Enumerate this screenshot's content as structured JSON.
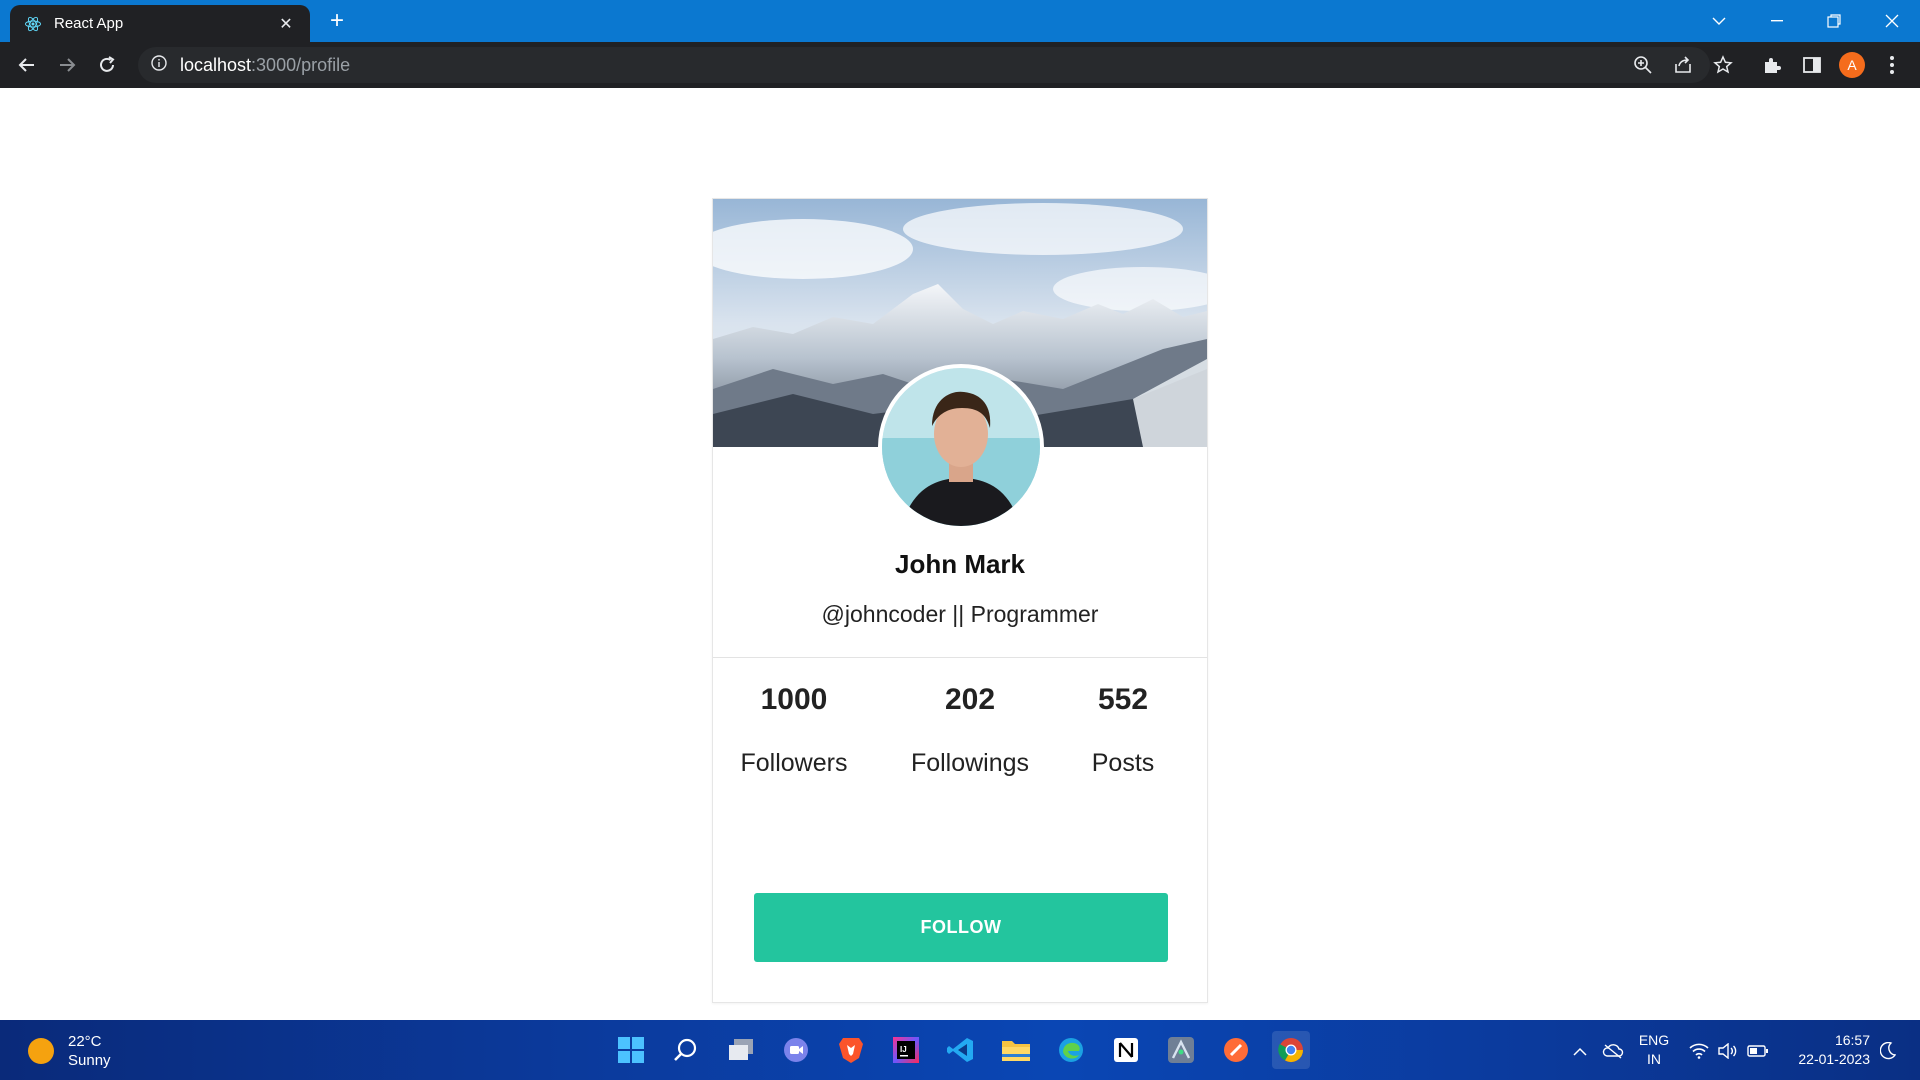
{
  "browser": {
    "tab_title": "React App",
    "url_host": "localhost",
    "url_path": ":3000/profile",
    "profile_initial": "A"
  },
  "profile": {
    "name": "John Mark",
    "handle": "@johncoder || Programmer",
    "stats": [
      {
        "value": "1000",
        "label": "Followers"
      },
      {
        "value": "202",
        "label": "Followings"
      },
      {
        "value": "552",
        "label": "Posts"
      }
    ],
    "follow_label": "FOLLOW"
  },
  "taskbar": {
    "temperature": "22°C",
    "condition": "Sunny",
    "lang_top": "ENG",
    "lang_bottom": "IN",
    "time": "16:57",
    "date": "22-01-2023"
  },
  "colors": {
    "tab_bar": "#0b78d0",
    "toolbar": "#202124",
    "follow_button": "#23c59e",
    "profile_chip": "#f56c1c"
  }
}
